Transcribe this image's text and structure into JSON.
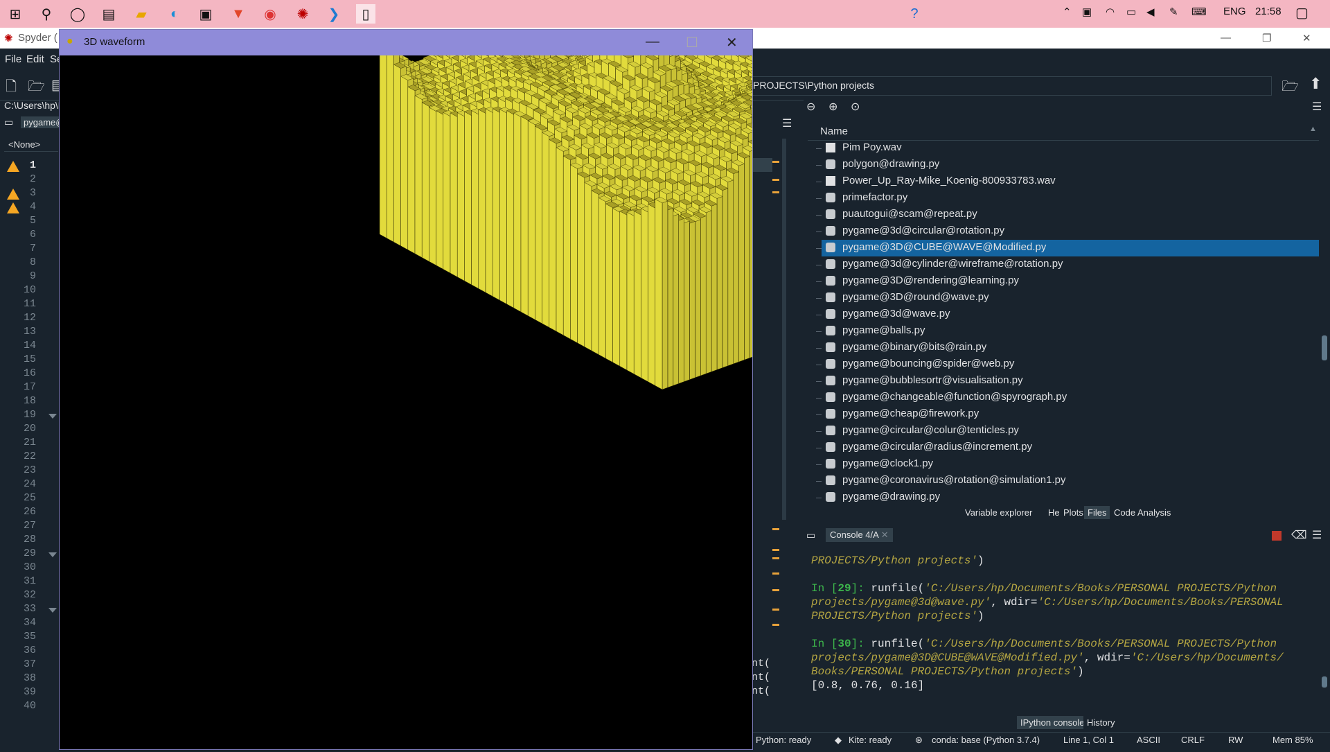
{
  "taskbar": {
    "language": "ENG",
    "time": "21:58",
    "icons": [
      "windows-start-icon",
      "search-icon",
      "cortana-icon",
      "task-view-icon",
      "file-explorer-icon",
      "edge-icon",
      "store-icon",
      "brave-icon",
      "chrome-icon",
      "spyder-icon",
      "vscode-icon",
      "blank-window-icon"
    ]
  },
  "spyder": {
    "title": "Spyder (",
    "menu": {
      "file": "File",
      "edit": "Edit",
      "search_partial": "Se"
    },
    "left_path": "C:\\Users\\hp\\D",
    "editor_tab": "pygame@",
    "outline_selector": "<None>",
    "path_box": "PROJECTS\\Python projects",
    "line_numbers": [
      "1",
      "2",
      "3",
      "4",
      "5",
      "6",
      "7",
      "8",
      "9",
      "10",
      "11",
      "12",
      "13",
      "14",
      "15",
      "16",
      "17",
      "18",
      "19",
      "20",
      "21",
      "22",
      "23",
      "24",
      "25",
      "26",
      "27",
      "28",
      "29",
      "30",
      "31",
      "32",
      "33",
      "34",
      "35",
      "36",
      "37",
      "38",
      "39",
      "40"
    ],
    "editor_snippets": [
      "nt(",
      "nt(",
      "nt("
    ]
  },
  "files": {
    "header": "Name",
    "items": [
      "Pim Poy.wav",
      "polygon@drawing.py",
      "Power_Up_Ray-Mike_Koenig-800933783.wav",
      "primefactor.py",
      "puautogui@scam@repeat.py",
      "pygame@3d@circular@rotation.py",
      "pygame@3D@CUBE@WAVE@Modified.py",
      "pygame@3d@cylinder@wireframe@rotation.py",
      "pygame@3D@rendering@learning.py",
      "pygame@3D@round@wave.py",
      "pygame@3d@wave.py",
      "pygame@balls.py",
      "pygame@binary@bits@rain.py",
      "pygame@bouncing@spider@web.py",
      "pygame@bubblesortr@visualisation.py",
      "pygame@changeable@function@spyrograph.py",
      "pygame@cheap@firework.py",
      "pygame@circular@colur@tenticles.py",
      "pygame@circular@radius@increment.py",
      "pygame@clock1.py",
      "pygame@coronavirus@rotation@simulation1.py",
      "pygame@drawing.py"
    ],
    "selected_index": 6
  },
  "pane_tabs": {
    "variable_explorer": "Variable explorer",
    "help": "Help",
    "plots": "Plots",
    "files": "Files",
    "code_analysis": "Code Analysis"
  },
  "console": {
    "tab": "Console 4/A",
    "lines": [
      {
        "parts": [
          {
            "t": "PROJECTS/Python projects'",
            "c": "str"
          },
          {
            "t": ")",
            "c": "white"
          }
        ]
      },
      {
        "parts": [
          {
            "t": "In [",
            "c": "green"
          },
          {
            "t": "29",
            "c": "green"
          },
          {
            "t": "]: ",
            "c": "green"
          },
          {
            "t": "runfile(",
            "c": "white"
          },
          {
            "t": "'C:/Users/hp/Documents/Books/PERSONAL PROJECTS/Python",
            "c": "str"
          }
        ]
      },
      {
        "parts": [
          {
            "t": "projects/pygame@3d@wave.py'",
            "c": "str"
          },
          {
            "t": ", wdir=",
            "c": "white"
          },
          {
            "t": "'C:/Users/hp/Documents/Books/PERSONAL",
            "c": "str"
          }
        ]
      },
      {
        "parts": [
          {
            "t": "PROJECTS/Python projects'",
            "c": "str"
          },
          {
            "t": ")",
            "c": "white"
          }
        ]
      },
      {
        "parts": [
          {
            "t": "In [",
            "c": "green"
          },
          {
            "t": "30",
            "c": "green"
          },
          {
            "t": "]: ",
            "c": "green"
          },
          {
            "t": "runfile(",
            "c": "white"
          },
          {
            "t": "'C:/Users/hp/Documents/Books/PERSONAL PROJECTS/Python",
            "c": "str"
          }
        ]
      },
      {
        "parts": [
          {
            "t": "projects/pygame@3D@CUBE@WAVE@Modified.py'",
            "c": "str"
          },
          {
            "t": ", wdir=",
            "c": "white"
          },
          {
            "t": "'C:/Users/hp/Documents/",
            "c": "str"
          }
        ]
      },
      {
        "parts": [
          {
            "t": "Books/PERSONAL PROJECTS/Python projects'",
            "c": "str"
          },
          {
            "t": ")",
            "c": "white"
          }
        ]
      },
      {
        "parts": [
          {
            "t": "[0.8, 0.76, 0.16]",
            "c": "white"
          }
        ]
      }
    ],
    "bottom_tabs": {
      "ipython": "IPython console",
      "history": "History"
    }
  },
  "statusbar": {
    "python": "Python: ready",
    "kite": "Kite: ready",
    "conda": "conda: base (Python 3.7.4)",
    "position": "Line 1, Col 1",
    "encoding": "ASCII",
    "eol": "CRLF",
    "permissions": "RW",
    "memory": "Mem 85%"
  },
  "pygame_window": {
    "title": "3D waveform",
    "minimize_glyph": "—",
    "maximize_glyph": "☐",
    "close_glyph": "✕",
    "grid_size": 40,
    "colors": {
      "top": "#a89f26",
      "top_light": "#d4cd3a",
      "side_left": "#c9c134",
      "side_right": "#e2db3c",
      "bg": "#000000"
    }
  }
}
